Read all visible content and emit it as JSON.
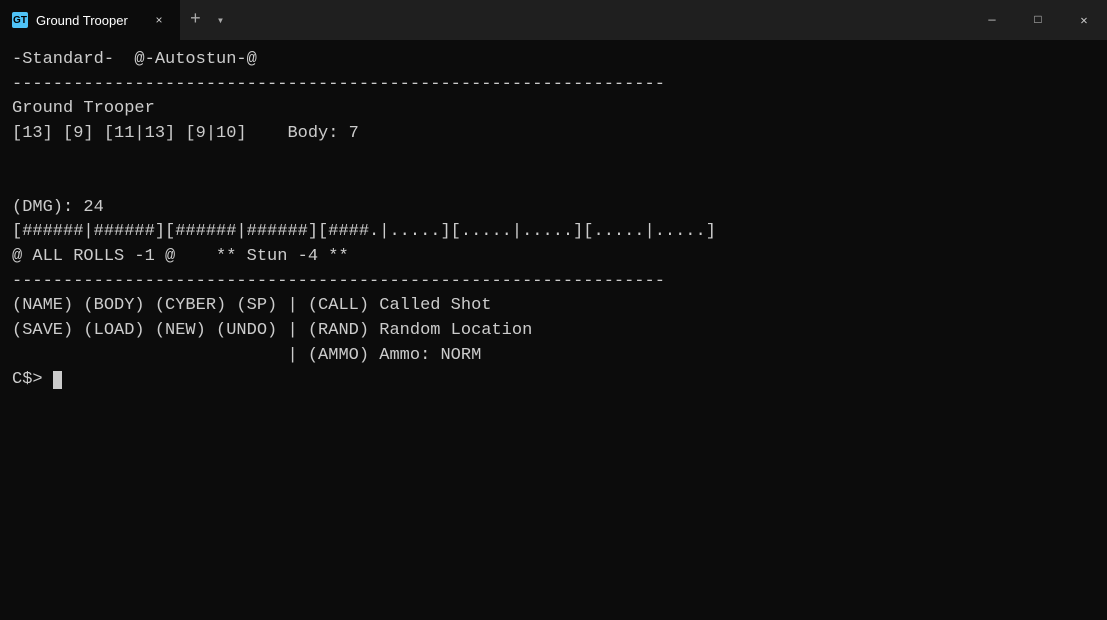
{
  "titlebar": {
    "icon_label": "GT",
    "tab_label": "Ground Trooper",
    "close_tab_label": "×",
    "new_tab_label": "+",
    "dropdown_label": "▾",
    "minimize_label": "—",
    "maximize_label": "□",
    "close_window_label": "✕"
  },
  "terminal": {
    "line1": "-Standard-  @-Autostun-@",
    "line2": "----------------------------------------------------------------",
    "line3": "Ground Trooper",
    "line4": "[13] [9] [11|13] [9|10]    Body: 7",
    "line5": "",
    "line6": "",
    "line7": "(DMG): 24",
    "line8": "[######|######][######|######][####.|.....][.....|.....][.....|.....]",
    "line9": "@ ALL ROLLS -1 @    ** Stun -4 **",
    "line10": "----------------------------------------------------------------",
    "line11": "(NAME) (BODY) (CYBER) (SP) | (CALL) Called Shot",
    "line12": "(SAVE) (LOAD) (NEW) (UNDO) | (RAND) Random Location",
    "line13": "                           | (AMMO) Ammo: NORM",
    "prompt": "C$> "
  }
}
